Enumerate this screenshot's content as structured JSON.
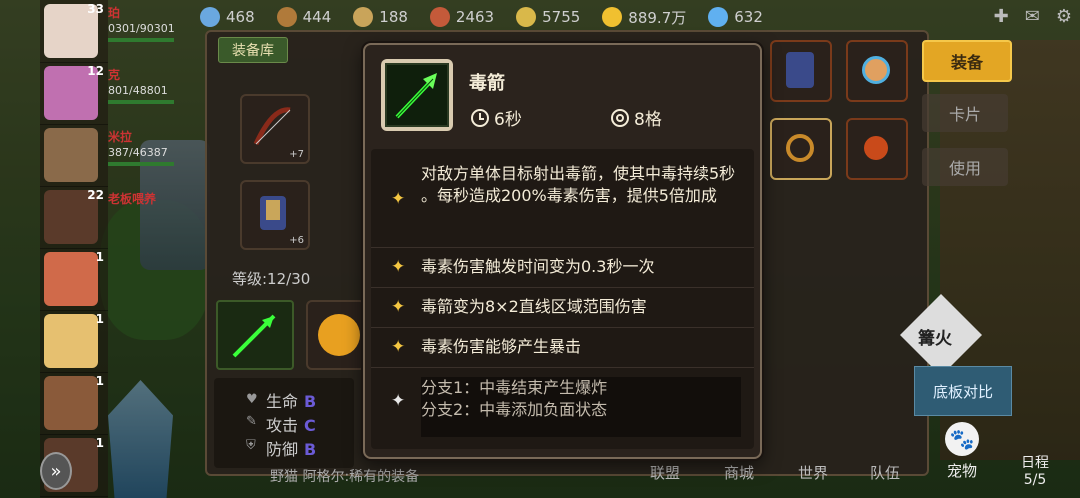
{
  "resources": [
    {
      "value": "468",
      "color": "#6aa8e0"
    },
    {
      "value": "444",
      "color": "#b07a3a"
    },
    {
      "value": "188",
      "color": "#c9a45a"
    },
    {
      "value": "2463",
      "color": "#c45a3a"
    },
    {
      "value": "5755",
      "color": "#d9b84a"
    },
    {
      "value": "889.7万",
      "color": "#f0c030"
    },
    {
      "value": "632",
      "color": "#60b0f0"
    }
  ],
  "party": [
    {
      "level": "33",
      "name": "珀",
      "hp": "0301/90301",
      "color": "#e6d4c8"
    },
    {
      "level": "12",
      "name": "克",
      "hp": "801/48801",
      "color": "#c070b0"
    },
    {
      "level": "",
      "name": "米拉",
      "hp": "387/46387",
      "color": "#8a6a4a"
    },
    {
      "level": "22",
      "name": "老板喂养",
      "hp": "",
      "color": "#5a3a2a"
    },
    {
      "level": "1",
      "name": "",
      "hp": "",
      "color": "#d06a4a"
    },
    {
      "level": "1",
      "name": "",
      "hp": "",
      "color": "#e6c070"
    },
    {
      "level": "1",
      "name": "",
      "hp": "",
      "color": "#8a5a3a"
    },
    {
      "level": "1",
      "name": "",
      "hp": "",
      "color": "#5a3a2a"
    }
  ],
  "panel": {
    "library_label": "装备库",
    "level_text": "等级:12/30",
    "slot_plus_1": "+7",
    "slot_plus_2": "+6",
    "stats": [
      {
        "label": "生命",
        "grade": "B"
      },
      {
        "label": "攻击",
        "grade": "C"
      },
      {
        "label": "防御",
        "grade": "B"
      }
    ],
    "chat": "野猫  阿格尔:稀有的装备"
  },
  "side": {
    "equip": "装备",
    "card": "卡片",
    "use": "使用",
    "bonfire": "篝火",
    "compare": "底板对比"
  },
  "bottom_nav": [
    "联盟",
    "商城",
    "世界",
    "队伍"
  ],
  "pet_label": "宠物",
  "schedule": {
    "label": "日程",
    "count": "5/5"
  },
  "tooltip": {
    "name": "毒箭",
    "duration": "6秒",
    "range": "8格",
    "lines": [
      {
        "text": "对敌方单体目标射出毒箭，使其中毒持续5秒 。每秒造成200%毒素伤害，提供5倍加成",
        "star": "gold"
      },
      {
        "text": "毒素伤害触发时间变为0.3秒一次",
        "star": "gold"
      },
      {
        "text": "毒箭变为8×2直线区域范围伤害",
        "star": "gold"
      },
      {
        "text": "毒素伤害能够产生暴击",
        "star": "gold"
      },
      {
        "text": "分支1：中毒结束产生爆炸\n分支2：中毒添加负面状态",
        "star": "gray"
      }
    ]
  }
}
